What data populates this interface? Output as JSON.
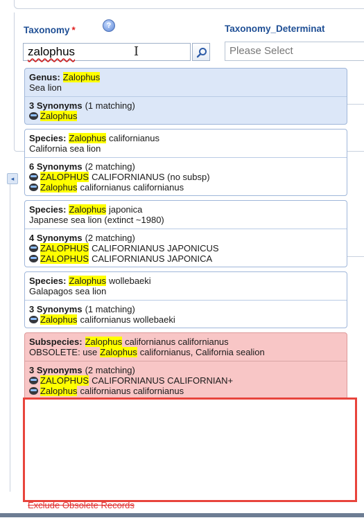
{
  "taxonomy": {
    "label": "Taxonomy",
    "required_mark": "*",
    "help_icon": "?",
    "value": "zalophus"
  },
  "determination": {
    "label": "Taxonomy_Determinat",
    "placeholder": "Please Select"
  },
  "results": [
    {
      "rank": "Genus:",
      "name_hl": "Zalophus",
      "name_rest": "",
      "common": "Sea lion",
      "syn_count": "3 Synonyms",
      "syn_matching": "(1 matching)",
      "synonyms": [
        {
          "hl": "Zalophus",
          "rest": ""
        }
      ]
    },
    {
      "rank": "Species:",
      "name_hl": "Zalophus",
      "name_rest": "californianus",
      "common": "California sea lion",
      "syn_count": "6 Synonyms",
      "syn_matching": "(2 matching)",
      "synonyms": [
        {
          "hl": "ZALOPHUS",
          "rest": "CALIFORNIANUS (no subsp)"
        },
        {
          "hl": "Zalophus",
          "rest": "californianus californianus"
        }
      ]
    },
    {
      "rank": "Species:",
      "name_hl": "Zalophus",
      "name_rest": "japonica",
      "common": "Japanese sea lion (extinct ~1980)",
      "syn_count": "4 Synonyms",
      "syn_matching": "(2 matching)",
      "synonyms": [
        {
          "hl": "ZALOPHUS",
          "rest": "CALIFORNIANUS JAPONICUS"
        },
        {
          "hl": "ZALOPHUS",
          "rest": "CALIFORNIANUS JAPONICA"
        }
      ]
    },
    {
      "rank": "Species:",
      "name_hl": "Zalophus",
      "name_rest": "wollebaeki",
      "common": "Galapagos sea lion",
      "syn_count": "3 Synonyms",
      "syn_matching": "(1 matching)",
      "synonyms": [
        {
          "hl": "Zalophus",
          "rest": "californianus wollebaeki"
        }
      ]
    },
    {
      "rank": "Subspecies:",
      "name_hl": "Zalophus",
      "name_rest": "californianus californianus",
      "common_pre": "OBSOLETE: use",
      "common_hl": "Zalophus",
      "common_post": "californianus, California sealion",
      "syn_count": "3 Synonyms",
      "syn_matching": "(2 matching)",
      "synonyms": [
        {
          "hl": "ZALOPHUS",
          "rest": "CALIFORNIANUS CALIFORNIAN+"
        },
        {
          "hl": "Zalophus",
          "rest": "californianus californianus"
        }
      ]
    }
  ],
  "exclude_obsolete": "Exclude Obsolete Records",
  "colors": {
    "highlight": "#ffff00",
    "selected_bg": "#dce7f8",
    "obsolete_bg": "#f8c6c6",
    "callout": "#e8443c",
    "label_blue": "#1f4f95"
  }
}
